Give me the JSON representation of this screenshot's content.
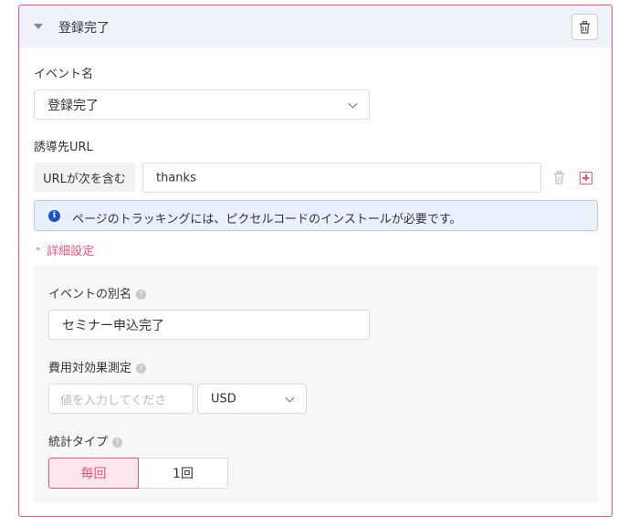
{
  "header": {
    "title": "登録完了"
  },
  "event_name": {
    "label": "イベント名",
    "value": "登録完了"
  },
  "destination_url": {
    "label": "誘導先URL",
    "match_type": "URLが次を含む",
    "value": "thanks"
  },
  "notice": {
    "text": "ページのトラッキングには、ピクセルコードのインストールが必要です。"
  },
  "advanced": {
    "toggle_label": "詳細設定",
    "alias": {
      "label": "イベントの別名",
      "value": "セミナー申込完了"
    },
    "cost": {
      "label": "費用対効果測定",
      "placeholder": "値を入力してくださ",
      "currency": "USD"
    },
    "count_type": {
      "label": "統計タイプ",
      "options": [
        "毎回",
        "1回"
      ],
      "selected": "毎回"
    }
  },
  "colors": {
    "accent": "#e2587c",
    "info_icon": "#1a56c8",
    "header_bg": "#f0f2fb"
  },
  "icons": [
    "caret-down-icon",
    "trash-icon",
    "chevron-down-icon",
    "plus-square-icon",
    "info-icon",
    "double-chevron-up-icon",
    "question-icon"
  ]
}
